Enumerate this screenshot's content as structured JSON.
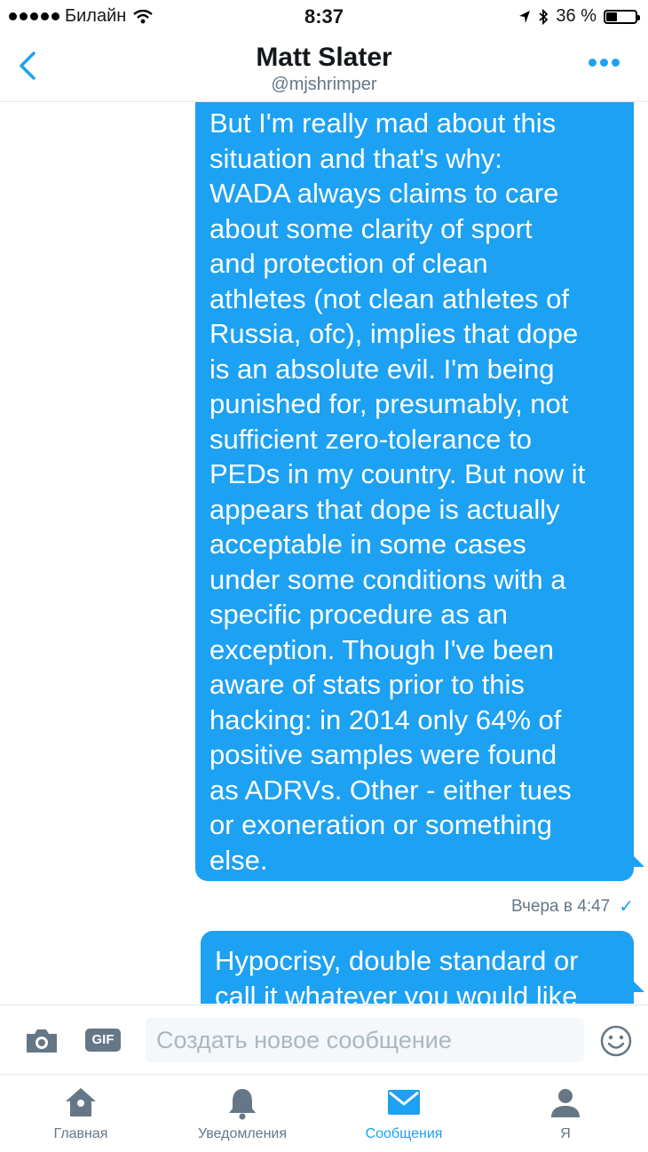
{
  "status_bar": {
    "carrier": "Билайн",
    "time": "8:37",
    "battery_text": "36 %",
    "battery_level": 0.36
  },
  "header": {
    "title": "Matt Slater",
    "handle": "@mjshrimper",
    "back_icon": "chevron-left-icon",
    "more_icon": "more-dots-icon"
  },
  "messages": [
    {
      "text": "But I'm really mad about this\nsituation and that's why:\nWADA always claims to care\nabout some clarity of sport\nand protection of clean\nathletes (not clean athletes of\nRussia, ofc), implies that dope\nis an absolute evil. I'm being\npunished for, presumably, not\nsufficient zero-tolerance to\nPEDs in my country. But now it\nappears that dope is actually\nacceptable in some cases\nunder some conditions with a\nspecific procedure as an\nexception. Though I've been\naware of stats prior to this\nhacking: in 2014 only 64% of\npositive samples were found\nas ADRVs. Other - either tues\nor exoneration or something\nelse.",
      "timestamp": "Вчера в 4:47",
      "status_icon": "checkmark-icon"
    },
    {
      "text": "Hypocrisy, double standard or\ncall it whatever you would like"
    }
  ],
  "compose": {
    "placeholder": "Создать новое сообщение",
    "value": "",
    "camera_icon": "camera-icon",
    "gif_label": "GIF",
    "emoji_icon": "emoji-icon"
  },
  "tabs": [
    {
      "label": "Главная",
      "icon": "home-icon",
      "active": false
    },
    {
      "label": "Уведомления",
      "icon": "bell-icon",
      "active": false
    },
    {
      "label": "Сообщения",
      "icon": "envelope-icon",
      "active": true
    },
    {
      "label": "Я",
      "icon": "person-icon",
      "active": false
    }
  ],
  "colors": {
    "accent": "#1da1f2",
    "muted": "#657786"
  }
}
